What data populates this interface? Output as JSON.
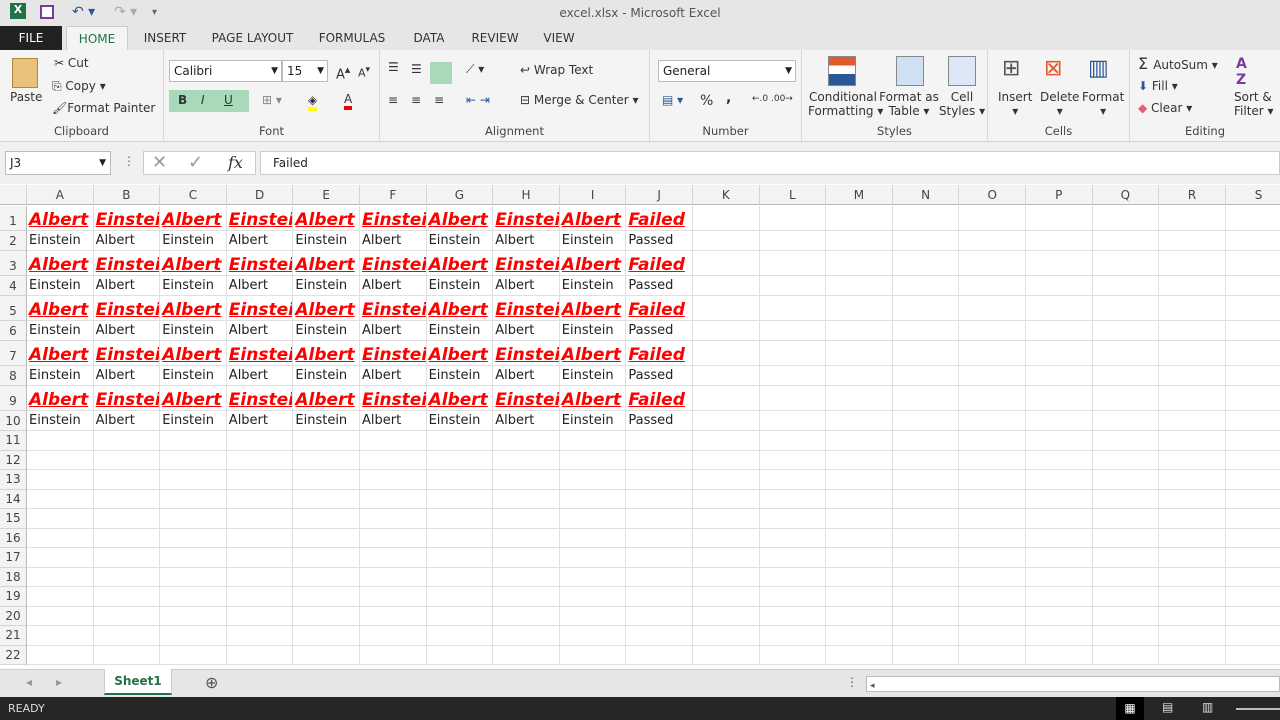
{
  "window": {
    "title": "excel.xlsx - Microsoft Excel"
  },
  "quick_access": {
    "excel_icon": "X",
    "save_icon": "save-icon",
    "undo": "↶ ▾",
    "redo": "↷ ▾",
    "customize": "▾"
  },
  "tabs": [
    "FILE",
    "HOME",
    "INSERT",
    "PAGE LAYOUT",
    "FORMULAS",
    "DATA",
    "REVIEW",
    "VIEW"
  ],
  "ribbon": {
    "clipboard": {
      "label": "Clipboard",
      "paste": "Paste",
      "cut": "Cut",
      "copy": "Copy",
      "format_painter": "Format Painter"
    },
    "font": {
      "label": "Font",
      "font_name": "Calibri",
      "font_size": "15",
      "bold": "B",
      "italic": "I",
      "underline": "U"
    },
    "alignment": {
      "label": "Alignment",
      "wrap_text": "Wrap Text",
      "merge_center": "Merge & Center"
    },
    "number": {
      "label": "Number",
      "format": "General",
      "percent": "%",
      "comma": ","
    },
    "styles": {
      "label": "Styles",
      "conditional_1": "Conditional",
      "conditional_2": "Formatting ▾",
      "format_table_1": "Format as",
      "format_table_2": "Table ▾",
      "cell_styles_1": "Cell",
      "cell_styles_2": "Styles ▾"
    },
    "cells": {
      "label": "Cells",
      "insert": "Insert",
      "delete": "Delete",
      "format": "Format"
    },
    "editing": {
      "label": "Editing",
      "autosum": "AutoSum",
      "fill": "Fill ▾",
      "clear": "Clear ▾",
      "sort_1": "Sort &",
      "sort_2": "Filter ▾"
    }
  },
  "formula_bar": {
    "name_box": "J3",
    "fx": "fx",
    "value": "Failed"
  },
  "columns": [
    "A",
    "B",
    "C",
    "D",
    "E",
    "F",
    "G",
    "H",
    "I",
    "J",
    "K",
    "L",
    "M",
    "N",
    "O",
    "P",
    "Q",
    "R",
    "S"
  ],
  "rows": [
    [
      "Albert",
      "Einstein",
      "Albert",
      "Einstein",
      "Albert",
      "Einstein",
      "Albert",
      "Einstein",
      "Albert",
      "Failed"
    ],
    [
      "Einstein",
      "Albert",
      "Einstein",
      "Albert",
      "Einstein",
      "Albert",
      "Einstein",
      "Albert",
      "Einstein",
      "Passed"
    ],
    [
      "Albert",
      "Einstein",
      "Albert",
      "Einstein",
      "Albert",
      "Einstein",
      "Albert",
      "Einstein",
      "Albert",
      "Failed"
    ],
    [
      "Einstein",
      "Albert",
      "Einstein",
      "Albert",
      "Einstein",
      "Albert",
      "Einstein",
      "Albert",
      "Einstein",
      "Passed"
    ],
    [
      "Albert",
      "Einstein",
      "Albert",
      "Einstein",
      "Albert",
      "Einstein",
      "Albert",
      "Einstein",
      "Albert",
      "Failed"
    ],
    [
      "Einstein",
      "Albert",
      "Einstein",
      "Albert",
      "Einstein",
      "Albert",
      "Einstein",
      "Albert",
      "Einstein",
      "Passed"
    ],
    [
      "Albert",
      "Einstein",
      "Albert",
      "Einstein",
      "Albert",
      "Einstein",
      "Albert",
      "Einstein",
      "Albert",
      "Failed"
    ],
    [
      "Einstein",
      "Albert",
      "Einstein",
      "Albert",
      "Einstein",
      "Albert",
      "Einstein",
      "Albert",
      "Einstein",
      "Passed"
    ],
    [
      "Albert",
      "Einstein",
      "Albert",
      "Einstein",
      "Albert",
      "Einstein",
      "Albert",
      "Einstein",
      "Albert",
      "Failed"
    ],
    [
      "Einstein",
      "Albert",
      "Einstein",
      "Albert",
      "Einstein",
      "Albert",
      "Einstein",
      "Albert",
      "Einstein",
      "Passed"
    ]
  ],
  "row_count": 22,
  "sheets": [
    "Sheet1"
  ],
  "add_sheet": "⊕",
  "status": {
    "text": "READY"
  },
  "colors": {
    "accent": "#217346",
    "highlight": "#ff0000"
  }
}
